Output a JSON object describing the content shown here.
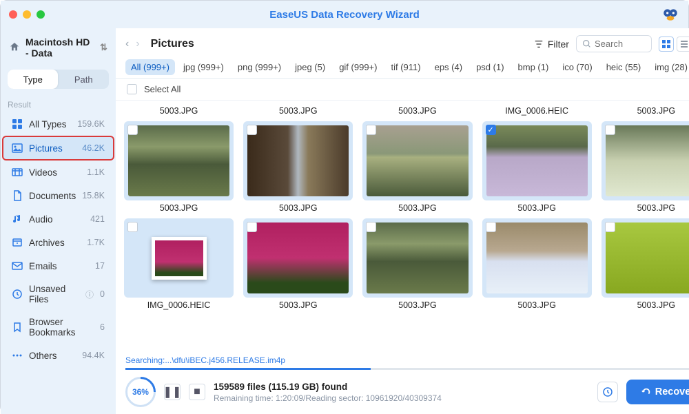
{
  "app": {
    "title": "EaseUS Data Recovery Wizard"
  },
  "volume": {
    "name": "Macintosh HD - Data"
  },
  "tabs": {
    "type": "Type",
    "path": "Path"
  },
  "sidebar": {
    "result_label": "Result",
    "items": [
      {
        "label": "All Types",
        "count": "159.6K"
      },
      {
        "label": "Pictures",
        "count": "46.2K"
      },
      {
        "label": "Videos",
        "count": "1.1K"
      },
      {
        "label": "Documents",
        "count": "15.8K"
      },
      {
        "label": "Audio",
        "count": "421"
      },
      {
        "label": "Archives",
        "count": "1.7K"
      },
      {
        "label": "Emails",
        "count": "17"
      },
      {
        "label": "Unsaved Files",
        "count": "0"
      },
      {
        "label": "Browser Bookmarks",
        "count": "6"
      },
      {
        "label": "Others",
        "count": "94.4K"
      }
    ]
  },
  "toolbar": {
    "breadcrumb": "Pictures",
    "filter_label": "Filter",
    "search_placeholder": "Search"
  },
  "filters": [
    "All (999+)",
    "jpg (999+)",
    "png (999+)",
    "jpeg (5)",
    "gif (999+)",
    "tif (911)",
    "eps (4)",
    "psd (1)",
    "bmp (1)",
    "ico (70)",
    "heic (55)",
    "img (28)"
  ],
  "select_all": "Select All",
  "files": {
    "row1_labels": [
      "5003.JPG",
      "5003.JPG",
      "5003.JPG",
      "IMG_0006.HEIC",
      "5003.JPG"
    ],
    "row1_checked_index": 3,
    "row2_labels": [
      "5003.JPG",
      "5003.JPG",
      "5003.JPG",
      "5003.JPG",
      "5003.JPG"
    ],
    "row3_labels": [
      "IMG_0006.HEIC",
      "5003.JPG",
      "5003.JPG",
      "5003.JPG",
      "5003.JPG"
    ]
  },
  "status": {
    "searching": "Searching:...\\dfu\\iBEC.j456.RELEASE.im4p",
    "progress_pct": "36%",
    "found": "159589 files (115.19 GB) found",
    "remaining": "Remaining time: 1:20:09/Reading sector: 10961920/40309374",
    "recover": "Recover"
  }
}
